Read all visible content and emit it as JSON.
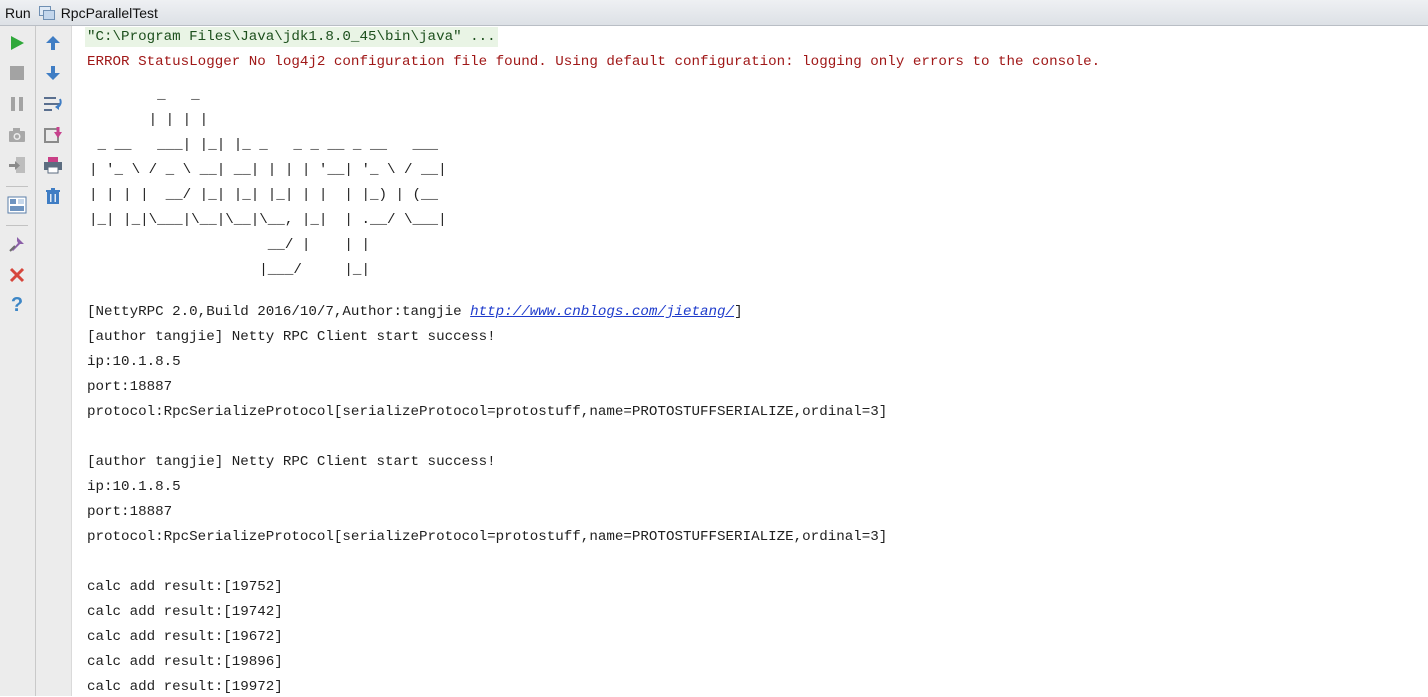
{
  "titlebar": {
    "run_label": "Run",
    "config_name": "RpcParallelTest"
  },
  "left_toolbar": [
    {
      "icon": "run-icon"
    },
    {
      "icon": "stop-icon"
    },
    {
      "icon": "pause-icon"
    },
    {
      "icon": "camera-icon"
    },
    {
      "icon": "exit-icon"
    },
    {
      "icon": "layout-icon"
    },
    {
      "icon": "pin-icon"
    },
    {
      "icon": "close-icon"
    },
    {
      "icon": "help-icon"
    }
  ],
  "right_toolbar": [
    {
      "icon": "arrow-up-icon"
    },
    {
      "icon": "arrow-down-icon"
    },
    {
      "icon": "soft-wrap-icon"
    },
    {
      "icon": "scroll-to-end-icon"
    },
    {
      "icon": "print-icon"
    },
    {
      "icon": "trash-icon"
    }
  ],
  "console": {
    "command": "\"C:\\Program Files\\Java\\jdk1.8.0_45\\bin\\java\" ...",
    "error": "ERROR StatusLogger No log4j2 configuration file found. Using default configuration: logging only errors to the console.",
    "ascii_art": "        _   _\n       | | | |\n _ __   ___| |_| |_ _   _ _ __ _ __   ___\n| '_ \\ / _ \\ __| __| | | | '__| '_ \\ / __|\n| | | |  __/ |_| |_| |_| | |  | |_) | (__\n|_| |_|\\___|\\__|\\__|\\__, |_|  | .__/ \\___|\n                     __/ |    | |\n                    |___/     |_|",
    "banner_prefix": "[NettyRPC 2.0,Build 2016/10/7,Author:tangjie ",
    "banner_link": "http://www.cnblogs.com/jietang/",
    "banner_suffix": "]",
    "client_blocks": [
      {
        "start": "[author tangjie] Netty RPC Client start success!",
        "ip": "ip:10.1.8.5",
        "port": "port:18887",
        "protocol": "protocol:RpcSerializeProtocol[serializeProtocol=protostuff,name=PROTOSTUFFSERIALIZE,ordinal=3]"
      },
      {
        "start": "[author tangjie] Netty RPC Client start success!",
        "ip": "ip:10.1.8.5",
        "port": "port:18887",
        "protocol": "protocol:RpcSerializeProtocol[serializeProtocol=protostuff,name=PROTOSTUFFSERIALIZE,ordinal=3]"
      }
    ],
    "results": [
      "calc add result:[19752]",
      "calc add result:[19742]",
      "calc add result:[19672]",
      "calc add result:[19896]",
      "calc add result:[19972]"
    ]
  },
  "colors": {
    "error_text": "#a01818",
    "command_bg": "#e9f4e5",
    "link": "#1f3ccc",
    "run_green": "#2fa83a"
  }
}
